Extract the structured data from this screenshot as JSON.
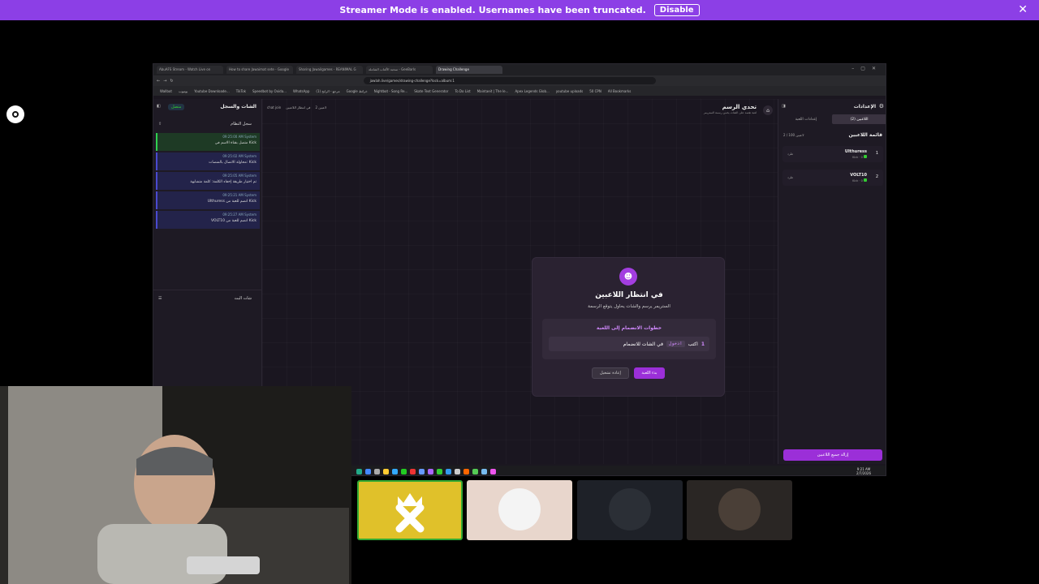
{
  "banner": {
    "message": "Streamer Mode is enabled. Usernames have been truncated.",
    "disable_label": "Disable"
  },
  "browser": {
    "tabs": [
      "AbuAFS Stream - Watch Live on",
      "How to share Jawaimat sete - Google",
      "Sharing Jawailgames - REANIMAL G",
      "سحبة الألعاب الشاملة - GeeBarls",
      "Drawing Challenge"
    ],
    "url": "jawlah.live/games/drawing-challenge?lock=album:1",
    "bookmarks": [
      "Wallbot",
      "يوتيوب",
      "Youtube Downloade...",
      "TikTok",
      "Speedbot by Oxida...",
      "WhatsApp",
      "مرجع - الرابح (1)",
      "Google خرائط",
      "Nightbot - Song Re...",
      "Skate Text Generator",
      "To Do List",
      "Maintaeit | The le...",
      "Apex Legends Glob...",
      "youtube uploads",
      "50 CPN",
      "All Bookmarks"
    ]
  },
  "left_panel": {
    "title": "الشات والسجل",
    "status_badge": "متصل",
    "log_title": "سجل النظام",
    "log_entries": [
      {
        "source": "System",
        "time": "09:25:00 AM",
        "text": "متصل بقناة الاسم في Kick"
      },
      {
        "source": "System",
        "time": "09:25:02 AM",
        "text": "محاولة الاتصال بالمنصات: Kick"
      },
      {
        "source": "System",
        "time": "09:25:05 AM",
        "text": "تم اختيار طريقة إخفاء الكلمة: كلمة متشابهة"
      },
      {
        "source": "System",
        "time": "09:25:21 AM",
        "text": "Ulthuress انضم للعبة من Kick"
      },
      {
        "source": "System",
        "time": "09:25:27 AM",
        "text": "VOLT10 انضم للعبة من Kick"
      }
    ],
    "live_chat_title": "شات البث"
  },
  "header": {
    "title": "تحدي الرسم",
    "subtitle": "لعبة تعتمد على الشات يخمن رسمة الستريمر",
    "breadcrumb_players": "2 لاعبين",
    "breadcrumb_state": "في انتظار اللاعبين",
    "breadcrumb_extra": "chat join"
  },
  "right_panel": {
    "title": "الإعدادات",
    "tab_players": "اللاعبين (2)",
    "tab_settings": "إعدادات اللعبة",
    "list_title": "قائمة اللاعبين",
    "count": "2 / 100 لاعبين",
    "players": [
      {
        "rank": "1",
        "name": "Ulthuress",
        "sub": "Kick · 0",
        "kick": "طرد"
      },
      {
        "rank": "2",
        "name": "VOLT10",
        "sub": "Kick · 0",
        "kick": "طرد"
      }
    ],
    "remove_all": "إزالة جميع اللاعبين"
  },
  "modal": {
    "title": "في انتظار اللاعبين",
    "subtitle": "الستريمر يرسم والشات يحاول يتوقع الرسمة",
    "steps_title": "خطوات الانضمام إلى اللعبة",
    "step_number": "1",
    "step_prefix": "اكتب",
    "step_command": "ادخول",
    "step_suffix": "في الشات للانضمام",
    "start_label": "بدء اللعبة",
    "reset_label": "إعادة تشغيل"
  },
  "taskbar": {
    "time": "9:21 AM",
    "date": "2/7/2026"
  },
  "colors": {
    "accent": "#9b2fd8",
    "banner": "#8c3fe6",
    "live_green": "#33cc33"
  }
}
